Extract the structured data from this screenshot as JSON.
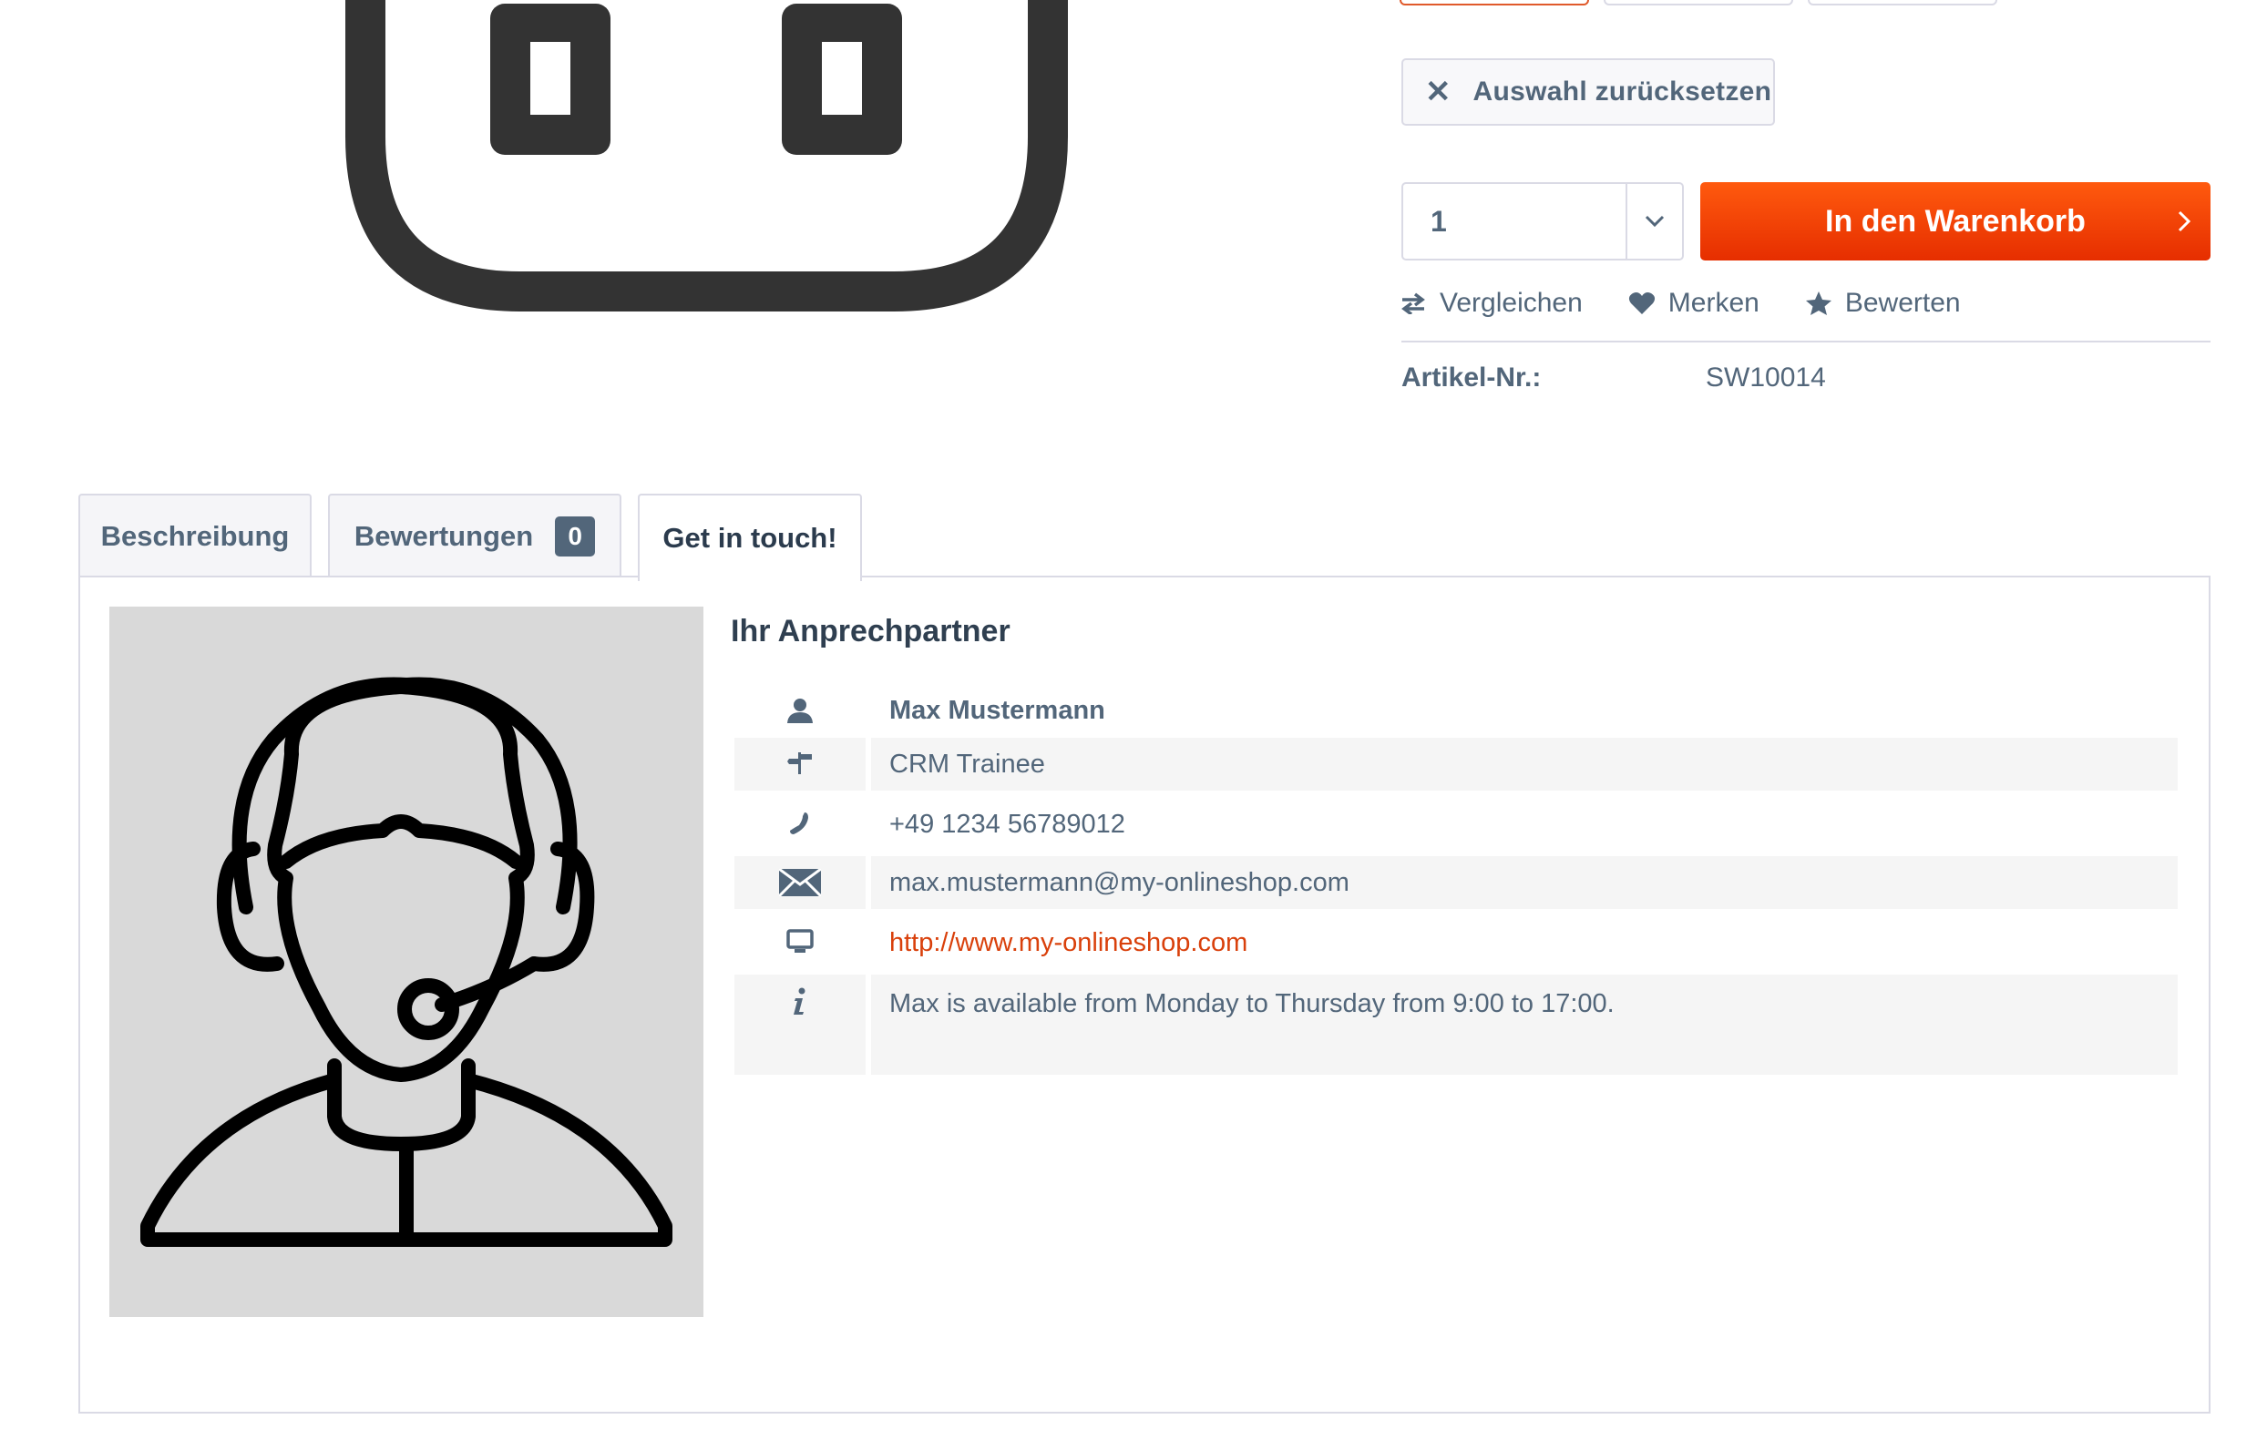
{
  "product": {
    "reset_label": "Auswahl zurücksetzen",
    "quantity": "1",
    "buy_label": "In den Warenkorb",
    "actions": [
      {
        "label": "Vergleichen",
        "icon": "compare-arrows-icon"
      },
      {
        "label": "Merken",
        "icon": "heart-icon"
      },
      {
        "label": "Bewerten",
        "icon": "star-icon"
      }
    ],
    "article_number_label": "Artikel-Nr.:",
    "article_number": "SW10014"
  },
  "tabs": [
    {
      "label": "Beschreibung",
      "active": false
    },
    {
      "label": "Bewertungen",
      "badge": "0",
      "active": false
    },
    {
      "label": "Get in touch!",
      "active": true
    }
  ],
  "contact": {
    "heading": "Ihr Anprechpartner",
    "rows": [
      {
        "icon": "user-icon",
        "text": "Max Mustermann"
      },
      {
        "icon": "signpost-icon",
        "text": "CRM Trainee"
      },
      {
        "icon": "phone-icon",
        "text": "+49 1234 56789012"
      },
      {
        "icon": "envelope-icon",
        "text": "max.mustermann@my-onlineshop.com"
      },
      {
        "icon": "monitor-icon",
        "text": "http://www.my-onlineshop.com"
      },
      {
        "icon": "info-icon",
        "text": "Max is available from Monday to Thursday from 9:00 to 17:00."
      }
    ]
  },
  "colors": {
    "accent": "#e62e00",
    "text": "#52667a",
    "border": "#dadae5"
  }
}
